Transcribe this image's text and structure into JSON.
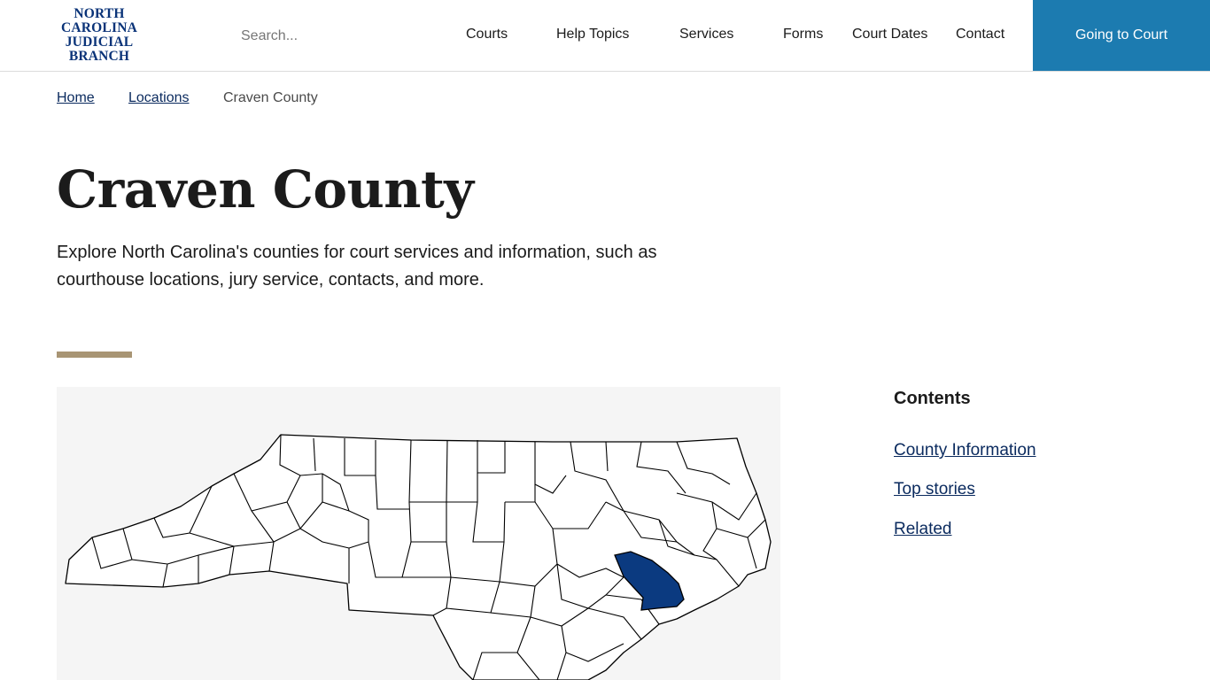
{
  "header": {
    "logo_lines": [
      "NORTH",
      "CAROLINA",
      "JUDICIAL",
      "BRANCH"
    ],
    "search_placeholder": "Search...",
    "nav": [
      "Courts",
      "Help Topics",
      "Services",
      "Forms",
      "Court Dates",
      "Contact"
    ],
    "cta_label": "Going to Court"
  },
  "breadcrumb": {
    "items": [
      "Home",
      "Locations"
    ],
    "current": "Craven County"
  },
  "page": {
    "title": "Craven County",
    "intro": "Explore North Carolina's counties for court services and information, such as courthouse locations, jury service, contacts, and more."
  },
  "map": {
    "highlighted_county": "Craven",
    "highlight_color": "#0b3a80",
    "fill_color": "#ffffff",
    "background_color": "#f5f5f5"
  },
  "contents": {
    "title": "Contents",
    "links": [
      "County Information",
      "Top stories",
      "Related"
    ]
  },
  "colors": {
    "brand_blue": "#0a3378",
    "cta_blue": "#1c7bb0",
    "accent_tan": "#a89574",
    "link_navy": "#0a2a5e"
  }
}
